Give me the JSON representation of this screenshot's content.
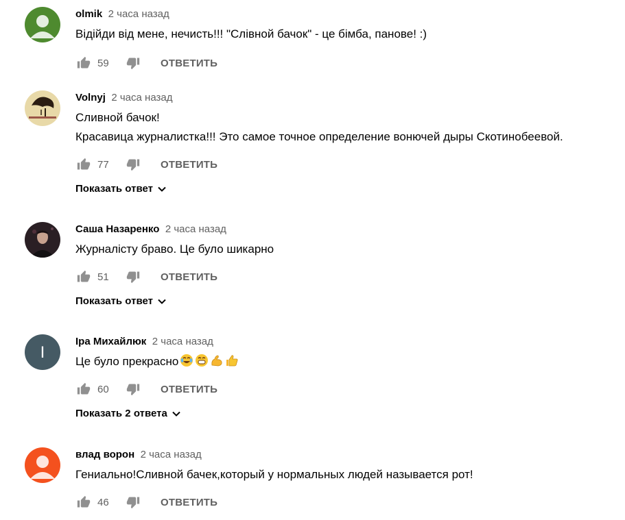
{
  "comments": [
    {
      "author": "olmik",
      "time": "2 часа назад",
      "text": "Відійди від мене, нечисть!!! \"Слівной бачок\" - це бімба, панове! :)",
      "likes": "59",
      "reply_label": "ОТВЕТИТЬ",
      "avatar_color": "#4e8a2f"
    },
    {
      "author": "Volnyj",
      "time": "2 часа назад",
      "text": "Сливной бачок!\n Красавица журналистка!!! Это самое точное определение вонючей дыры Скотинобеевой.",
      "likes": "77",
      "reply_label": "ОТВЕТИТЬ",
      "show_replies": "Показать ответ",
      "avatar_color": "#e8d9a8"
    },
    {
      "author": "Саша Назаренко",
      "time": "2 часа назад",
      "text": "Журналісту браво. Це було шикарно",
      "likes": "51",
      "reply_label": "ОТВЕТИТЬ",
      "show_replies": "Показать ответ",
      "avatar_color": "#2a1f24"
    },
    {
      "author": "Іра Михайлюк",
      "time": "2 часа назад",
      "text": "Це було прекрасно",
      "likes": "60",
      "reply_label": "ОТВЕТИТЬ",
      "show_replies": "Показать 2 ответа",
      "avatar_letter": "І",
      "avatar_color": "#455a64"
    },
    {
      "author": "влад ворон",
      "time": "2 часа назад",
      "text": "Гениально!Сливной бачек,который у нормальных людей называется рот!",
      "likes": "46",
      "reply_label": "ОТВЕТИТЬ",
      "avatar_color": "#f4511e"
    }
  ],
  "emoji_icons": [
    "face-with-tears-of-joy",
    "grinning-face",
    "flexed-biceps",
    "thumbs-up"
  ]
}
